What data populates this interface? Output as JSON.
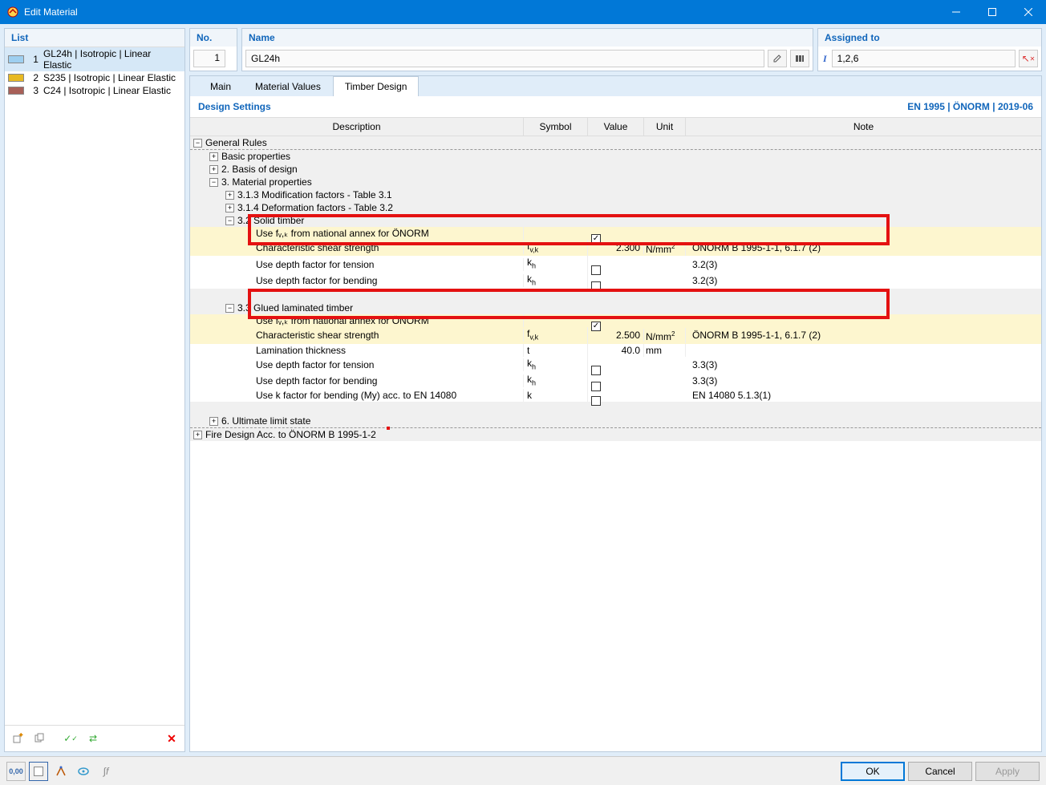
{
  "window": {
    "title": "Edit Material"
  },
  "sidebar": {
    "header": "List",
    "items": [
      {
        "num": "1",
        "color": "#9ecff0",
        "label": "GL24h | Isotropic | Linear Elastic",
        "selected": true
      },
      {
        "num": "2",
        "color": "#e8b923",
        "label": "S235 | Isotropic | Linear Elastic",
        "selected": false
      },
      {
        "num": "3",
        "color": "#a86058",
        "label": "C24 | Isotropic | Linear Elastic",
        "selected": false
      }
    ]
  },
  "fields": {
    "no_label": "No.",
    "no_value": "1",
    "name_label": "Name",
    "name_value": "GL24h",
    "assigned_label": "Assigned to",
    "assigned_value": "1,2,6"
  },
  "tabs": {
    "main": "Main",
    "values": "Material Values",
    "timber": "Timber Design"
  },
  "settings": {
    "title": "Design Settings",
    "standard": "EN 1995 | ÖNORM | 2019-06"
  },
  "columns": {
    "desc": "Description",
    "sym": "Symbol",
    "val": "Value",
    "unit": "Unit",
    "note": "Note"
  },
  "tree": {
    "general_rules": "General Rules",
    "basic_props": "Basic properties",
    "basis_design": "2. Basis of design",
    "mat_props": "3. Material properties",
    "mod_factors": "3.1.3 Modification factors - Table 3.1",
    "def_factors": "3.1.4 Deformation factors - Table 3.2",
    "solid_timber": "3.2 Solid timber",
    "use_fvk_1": "Use fᵥ,ₖ from national annex for ÖNORM",
    "char_shear_1": {
      "desc": "Characteristic shear strength",
      "sym": "fᵥ,ₖ",
      "val": "2.300",
      "unit": "N/mm²",
      "note": "ÖNORM B 1995-1-1, 6.1.7 (2)"
    },
    "depth_tension_1": {
      "desc": "Use depth factor for tension",
      "sym": "kₕ",
      "note": "3.2(3)"
    },
    "depth_bending_1": {
      "desc": "Use depth factor for bending",
      "sym": "kₕ",
      "note": "3.2(3)"
    },
    "glued_timber": "3.3 Glued laminated timber",
    "use_fvk_2": "Use fᵥ,ₖ from national annex for ÖNORM",
    "char_shear_2": {
      "desc": "Characteristic shear strength",
      "sym": "fᵥ,ₖ",
      "val": "2.500",
      "unit": "N/mm²",
      "note": "ÖNORM B 1995-1-1, 6.1.7 (2)"
    },
    "lam_thick": {
      "desc": "Lamination thickness",
      "sym": "t",
      "val": "40.0",
      "unit": "mm"
    },
    "depth_tension_2": {
      "desc": "Use depth factor for tension",
      "sym": "kₕ",
      "note": "3.3(3)"
    },
    "depth_bending_2": {
      "desc": "Use depth factor for bending",
      "sym": "kₕ",
      "note": "3.3(3)"
    },
    "k_factor": {
      "desc": "Use k factor for bending (My) acc. to EN 14080",
      "sym": "k",
      "note": "EN 14080 5.1.3(1)"
    },
    "ult_limit": "6. Ultimate limit state",
    "fire_design": "Fire Design Acc. to ÖNORM B 1995-1-2"
  },
  "buttons": {
    "ok": "OK",
    "cancel": "Cancel",
    "apply": "Apply"
  }
}
